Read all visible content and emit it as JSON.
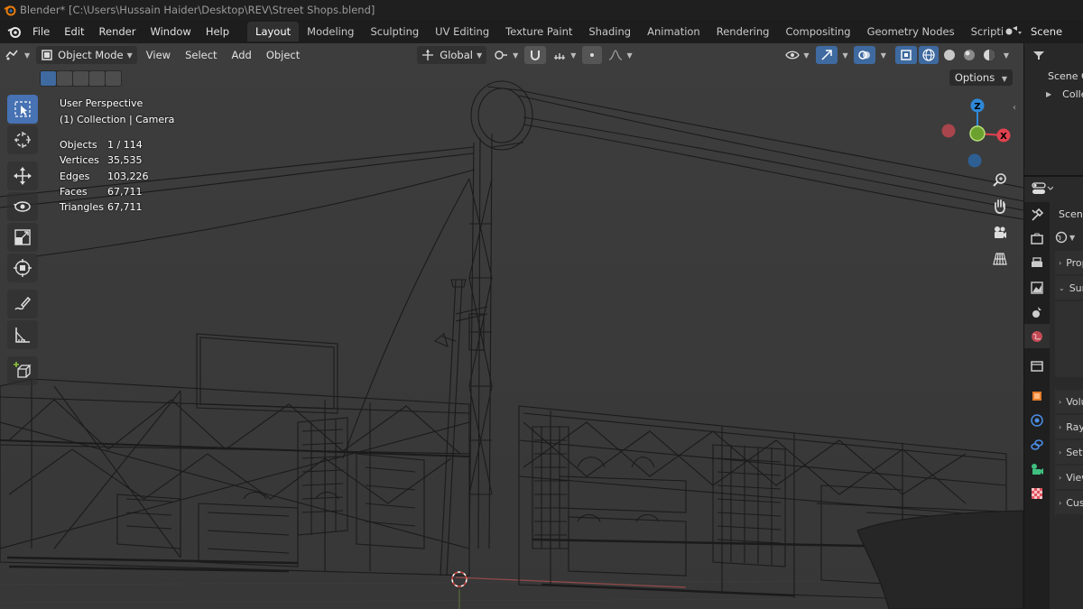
{
  "window": {
    "title": "Blender* [C:\\Users\\Hussain Haider\\Desktop\\REV\\Street Shops.blend]"
  },
  "menu": {
    "items": [
      "File",
      "Edit",
      "Render",
      "Window",
      "Help"
    ]
  },
  "workspaces": {
    "tabs": [
      "Layout",
      "Modeling",
      "Sculpting",
      "UV Editing",
      "Texture Paint",
      "Shading",
      "Animation",
      "Rendering",
      "Compositing",
      "Geometry Nodes",
      "Scripting"
    ],
    "active": "Layout",
    "add": "+"
  },
  "scene": {
    "label": "Scene"
  },
  "viewport_header": {
    "mode": "Object Mode",
    "menus": [
      "View",
      "Select",
      "Add",
      "Object"
    ],
    "orientation": "Global"
  },
  "viewport": {
    "perspective": "User Perspective",
    "collection": "(1) Collection | Camera",
    "options": "Options",
    "stats": [
      {
        "label": "Objects",
        "value": "1 / 114"
      },
      {
        "label": "Vertices",
        "value": "35,535"
      },
      {
        "label": "Edges",
        "value": "103,226"
      },
      {
        "label": "Faces",
        "value": "67,711"
      },
      {
        "label": "Triangles",
        "value": "67,711"
      }
    ],
    "gizmo": {
      "z": "Z",
      "x": "X"
    }
  },
  "outliner": {
    "row1": "Scene Collection",
    "row2": "Collection"
  },
  "properties": {
    "top": "Scene",
    "sections": [
      "Properties",
      "Surface",
      "Volume",
      "Ray Visibility",
      "Settings",
      "Viewport Display",
      "Custom Properties"
    ]
  },
  "colors": {
    "accent": "#4772b3",
    "viewport_bg": "#3b3b3b",
    "axis_x": "#e0424f",
    "axis_y": "#8bc33c",
    "axis_z": "#2f88d6"
  }
}
